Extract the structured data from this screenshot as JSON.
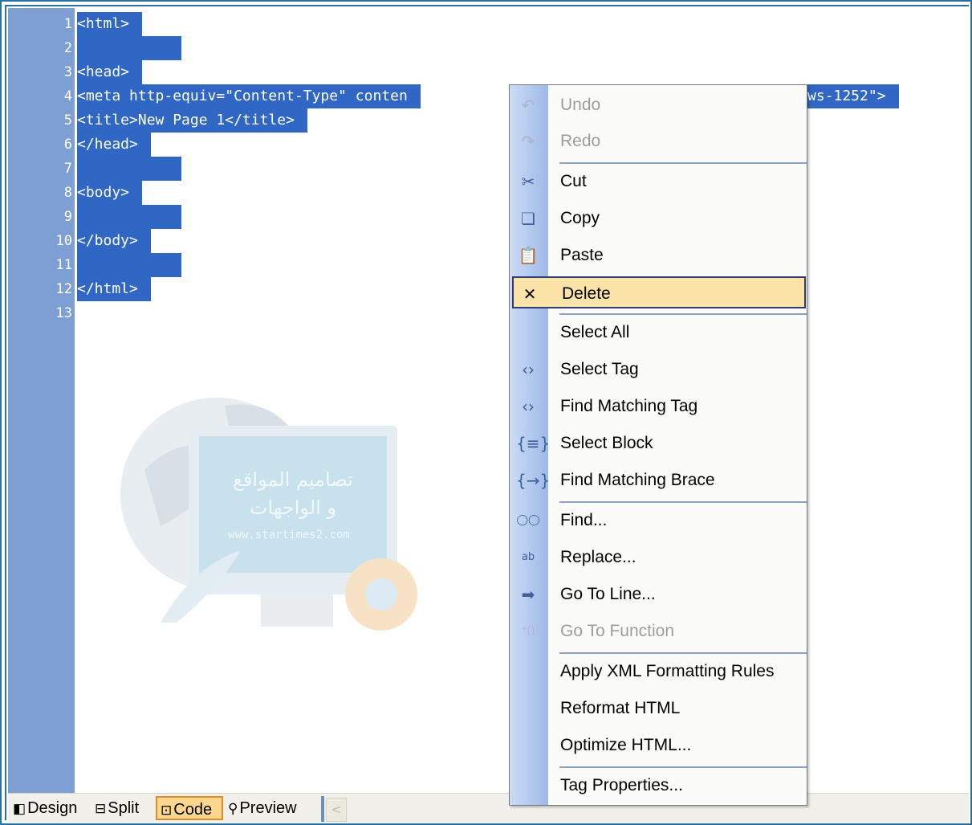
{
  "editor": {
    "line_numbers": [
      "1",
      "2",
      "3",
      "4",
      "5",
      "6",
      "7",
      "8",
      "9",
      "10",
      "11",
      "12",
      "13"
    ],
    "lines": [
      "<html>",
      "",
      "<head>",
      "<meta http-equiv=\"Content-Type\" conten",
      "<title>New Page 1</title>",
      "</head>",
      "",
      "<body>",
      "",
      "</body>",
      "",
      "</html>"
    ],
    "line4_tail": "ws-1252\">",
    "selection_color": "#3066c4",
    "gutter_color": "#7e9fd3"
  },
  "watermark": {
    "arabic_line1": "تصاميم المواقع",
    "arabic_line2": "و الواجهات",
    "url": "www.startimes2.com"
  },
  "view_tabs": [
    {
      "label": "Design",
      "icon": "design-view-icon"
    },
    {
      "label": "Split",
      "icon": "split-view-icon"
    },
    {
      "label": "Code",
      "icon": "code-view-icon",
      "active": true
    },
    {
      "label": "Preview",
      "icon": "preview-magnifier-icon"
    }
  ],
  "context_menu": {
    "items": [
      {
        "label": "Undo",
        "icon": "undo-icon",
        "disabled": true
      },
      {
        "label": "Redo",
        "icon": "redo-icon",
        "disabled": true
      },
      {
        "label": "Cut",
        "icon": "scissors-icon"
      },
      {
        "label": "Copy",
        "icon": "copy-icon"
      },
      {
        "label": "Paste",
        "icon": "paste-icon"
      },
      {
        "label": "Delete",
        "icon": "delete-x-icon",
        "highlighted": true
      },
      {
        "label": "Select All",
        "icon": ""
      },
      {
        "label": "Select Tag",
        "icon": "select-tag-icon"
      },
      {
        "label": "Find Matching Tag",
        "icon": "find-matching-tag-icon"
      },
      {
        "label": "Select Block",
        "icon": "select-block-icon"
      },
      {
        "label": "Find Matching Brace",
        "icon": "find-matching-brace-icon"
      },
      {
        "label": "Find...",
        "icon": "binoculars-icon"
      },
      {
        "label": "Replace...",
        "icon": "replace-icon"
      },
      {
        "label": "Go To Line...",
        "icon": "arrow-right-icon"
      },
      {
        "label": "Go To Function",
        "icon": "go-to-function-icon",
        "disabled": true
      },
      {
        "label": "Apply XML Formatting Rules",
        "icon": ""
      },
      {
        "label": "Reformat HTML",
        "icon": ""
      },
      {
        "label": "Optimize HTML...",
        "icon": ""
      },
      {
        "label": "Tag Properties...",
        "icon": ""
      }
    ],
    "highlight_color": "#fbe2a7"
  }
}
